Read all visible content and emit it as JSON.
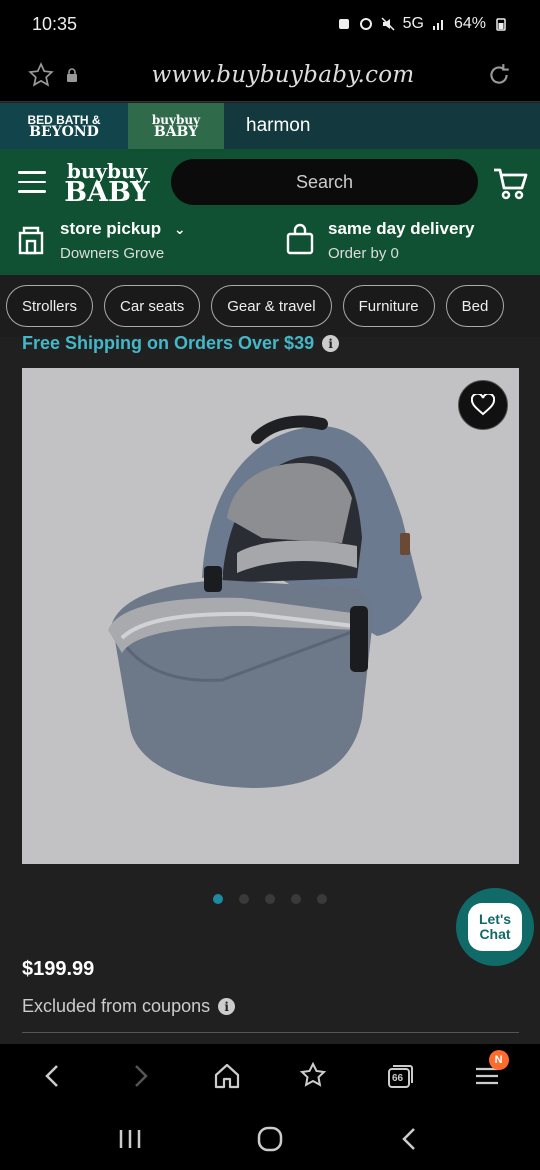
{
  "status_bar": {
    "time": "10:35",
    "network": "5G",
    "battery": "64%"
  },
  "browser": {
    "url": "www.buybuybaby.com"
  },
  "brand_bar": {
    "bbb_line1": "BED BATH &",
    "bbb_line2": "BEYOND",
    "bbby_line1": "buybuy",
    "bbby_line2": "BABY",
    "store_name": "harmon"
  },
  "header": {
    "logo_line1": "buybuy",
    "logo_line2": "BABY",
    "search_placeholder": "Search",
    "pickup": {
      "title": "store pickup",
      "detail": "Downers Grove"
    },
    "delivery": {
      "title": "same day delivery",
      "detail": "Order by 0"
    }
  },
  "categories": [
    "Strollers",
    "Car seats",
    "Gear & travel",
    "Furniture",
    "Bed"
  ],
  "shipping_banner": "Free Shipping on Orders Over $39",
  "carousel": {
    "total": 5,
    "active": 0
  },
  "chat": {
    "line1": "Let's",
    "line2": "Chat"
  },
  "product": {
    "price": "$199.99",
    "coupon_note": "Excluded from coupons"
  },
  "browser_nav": {
    "tabs_count": "66",
    "menu_badge": "N"
  },
  "colors": {
    "header_green": "#0f5132",
    "accent_teal": "#43b8c8",
    "chat_teal": "#0f6a68"
  }
}
